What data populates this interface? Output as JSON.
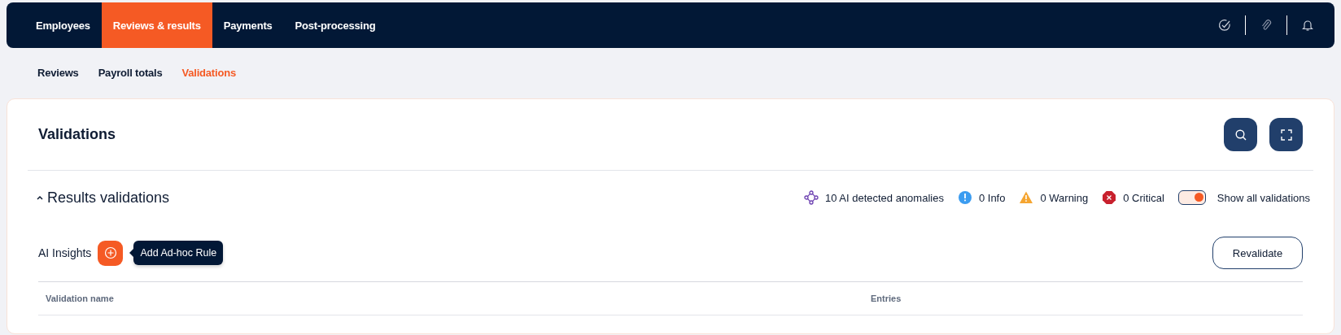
{
  "nav_tabs": [
    {
      "label": "Employees",
      "selected": false
    },
    {
      "label": "Reviews & results",
      "selected": true
    },
    {
      "label": "Payments",
      "selected": false
    },
    {
      "label": "Post-processing",
      "selected": false
    }
  ],
  "sub_tabs": [
    {
      "label": "Reviews",
      "selected": false
    },
    {
      "label": "Payroll totals",
      "selected": false
    },
    {
      "label": "Validations",
      "selected": true
    }
  ],
  "page_title": "Validations",
  "section": {
    "title": "Results validations",
    "expanded": true,
    "summary": [
      {
        "kind": "anomaly",
        "text": "10 AI detected anomalies"
      },
      {
        "kind": "info",
        "text": "0 Info"
      },
      {
        "kind": "warning",
        "text": "0 Warning"
      },
      {
        "kind": "critical",
        "text": "0 Critical"
      }
    ],
    "toggle": {
      "label": "Show all validations",
      "on": true
    }
  },
  "insights": {
    "title": "AI Insights",
    "tooltip": "Add Ad-hoc Rule",
    "button": "Revalidate"
  },
  "table": {
    "columns": [
      "Validation name",
      "Entries"
    ]
  }
}
